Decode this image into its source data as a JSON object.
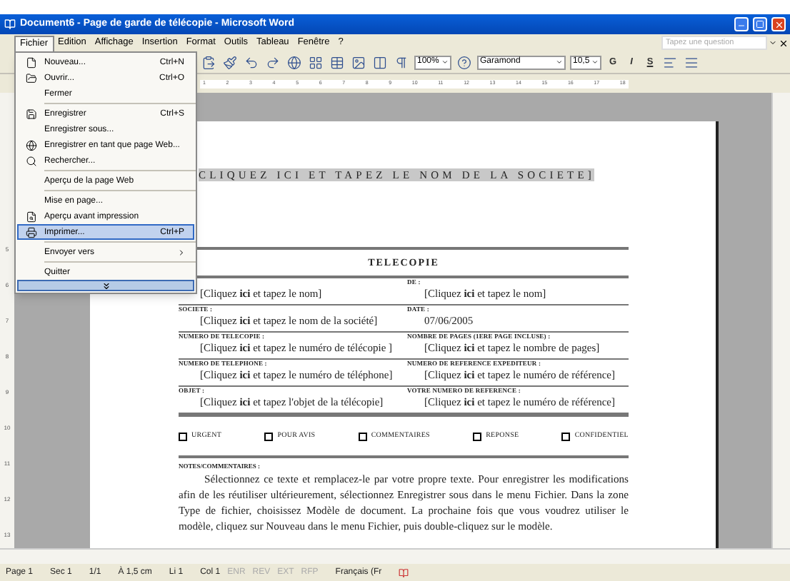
{
  "window": {
    "title": "Document6 - Page de garde de télécopie - Microsoft Word"
  },
  "menu_bar": [
    {
      "label": "Fichier",
      "selected": true
    },
    {
      "label": "Edition",
      "selected": false
    },
    {
      "label": "Affichage",
      "selected": false
    },
    {
      "label": "Insertion",
      "selected": false
    },
    {
      "label": "Format",
      "selected": false
    },
    {
      "label": "Outils",
      "selected": false
    },
    {
      "label": "Tableau",
      "selected": false
    },
    {
      "label": "Fenêtre",
      "selected": false
    },
    {
      "label": "?",
      "selected": false
    }
  ],
  "question_box": {
    "placeholder": "Tapez une question"
  },
  "toolbar": {
    "zoom": "100%",
    "font": "Garamond",
    "size": "10,5",
    "format_buttons": [
      "G",
      "I",
      "S"
    ]
  },
  "file_menu": [
    {
      "kind": "item",
      "label": "Nouveau...",
      "shortcut": "Ctrl+N",
      "selected": false
    },
    {
      "kind": "item",
      "label": "Ouvrir...",
      "shortcut": "Ctrl+O",
      "selected": false
    },
    {
      "kind": "item",
      "label": "Fermer",
      "selected": false
    },
    {
      "kind": "separator"
    },
    {
      "kind": "item",
      "label": "Enregistrer",
      "shortcut": "Ctrl+S",
      "selected": false
    },
    {
      "kind": "item",
      "label": "Enregistrer sous...",
      "selected": false
    },
    {
      "kind": "item",
      "label": "Enregistrer en tant que page Web...",
      "selected": false
    },
    {
      "kind": "item",
      "label": "Rechercher...",
      "selected": false
    },
    {
      "kind": "separator"
    },
    {
      "kind": "item",
      "label": "Aperçu de la page Web",
      "selected": false
    },
    {
      "kind": "separator"
    },
    {
      "kind": "item",
      "label": "Mise en page...",
      "selected": false
    },
    {
      "kind": "item",
      "label": "Aperçu avant impression",
      "selected": false
    },
    {
      "kind": "item",
      "label": "Imprimer...",
      "shortcut": "Ctrl+P",
      "selected": true
    },
    {
      "kind": "separator"
    },
    {
      "kind": "submenu",
      "label": "Envoyer vers",
      "selected": false
    },
    {
      "kind": "separator"
    },
    {
      "kind": "item",
      "label": "Quitter",
      "selected": false
    },
    {
      "kind": "expand"
    }
  ],
  "ruler": {
    "marks": [
      "1",
      "2",
      "3",
      "4",
      "5",
      "6",
      "7",
      "8",
      "9",
      "10",
      "11",
      "12",
      "13",
      "14",
      "15",
      "16",
      "17",
      "18"
    ]
  },
  "vertical_ruler": {
    "marks": [
      "5",
      "6",
      "7",
      "8",
      "9",
      "10",
      "11",
      "12",
      "13"
    ]
  },
  "document": {
    "company": "CLIQUEZ ICI ET TAPEZ LE NOM DE LA SOCIETE]",
    "heading": "TELECOPIE",
    "rows": [
      {
        "left_value": "[Cliquez **ici** et tapez le nom]",
        "right_label": "DE :",
        "right_value": "[Cliquez **ici** et tapez le nom]"
      },
      {
        "left_label": "SOCIETE :",
        "left_value": "[Cliquez **ici** et tapez le nom de la société]",
        "right_label": "DATE :",
        "right_value": "07/06/2005"
      },
      {
        "left_label": "NUMERO DE TELECOPIE :",
        "left_value": "[Cliquez **ici** et tapez le numéro de télécopie ]",
        "right_label": "NOMBRE DE PAGES (1ERE PAGE INCLUSE) :",
        "right_value": "[Cliquez **ici** et tapez le nombre de pages]"
      },
      {
        "left_label": "NUMERO DE TELEPHONE :",
        "left_value": "[Cliquez **ici** et tapez le numéro de téléphone]",
        "right_label": "NUMERO DE REFERENCE EXPEDITEUR :",
        "right_value": "[Cliquez **ici** et tapez le numéro de référence]"
      },
      {
        "left_label": "OBJET :",
        "left_value": "[Cliquez **ici** et tapez l'objet de la télécopie]",
        "right_label": "VOTRE NUMERO DE REFERENCE :",
        "right_value": "[Cliquez **ici** et tapez le numéro de référence]"
      }
    ],
    "checkboxes": [
      {
        "label": "URGENT",
        "checked": false
      },
      {
        "label": "POUR AVIS",
        "checked": false
      },
      {
        "label": "COMMENTAIRES",
        "checked": false
      },
      {
        "label": "REPONSE",
        "checked": false
      },
      {
        "label": "CONFIDENTIEL",
        "checked": false
      }
    ],
    "notes_label": "NOTES/COMMENTAIRES :",
    "notes": [
      "Sélectionnez ce texte et remplacez-le par votre propre texte. Pour enregistrer les modifications afin de les réutiliser ultérieurement, sélectionnez Enregistrer sous dans le menu Fichier. Dans la zone Type de fichier, choisissez Modèle de document. La prochaine fois que vous voudrez utiliser le modèle, cliquez sur Nouveau dans le menu Fichier, puis double-cliquez sur le modèle."
    ]
  },
  "status_bar": [
    {
      "text": "Page 1",
      "disabled": false
    },
    {
      "text": "Sec 1",
      "disabled": false
    },
    {
      "text": "1/1",
      "disabled": false
    },
    {
      "text": "À 1,5 cm",
      "disabled": false
    },
    {
      "text": "Li 1",
      "disabled": false
    },
    {
      "text": "Col 1",
      "disabled": false
    },
    {
      "text": "ENR",
      "disabled": true
    },
    {
      "text": "REV",
      "disabled": true
    },
    {
      "text": "EXT",
      "disabled": true
    },
    {
      "text": "RFP",
      "disabled": true
    },
    {
      "text": "Français (Fr",
      "disabled": false
    }
  ]
}
